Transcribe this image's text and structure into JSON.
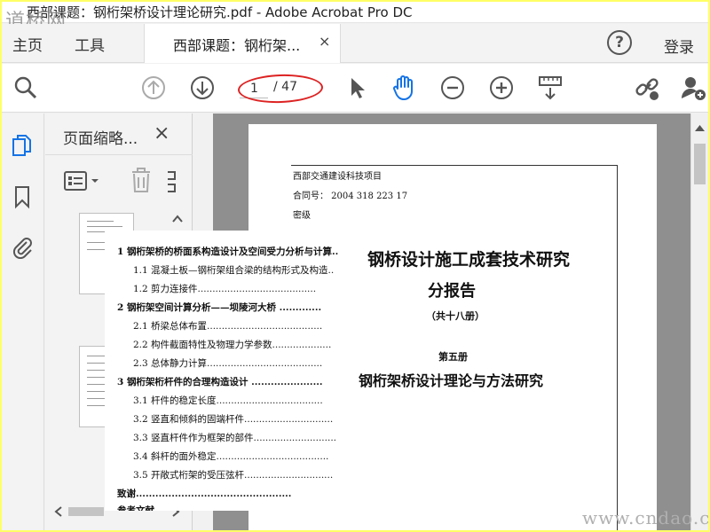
{
  "titlebar": {
    "title": "西部课题：钢桁架桥设计理论研究.pdf - Adobe Acrobat Pro DC",
    "logo_text": "道桥网"
  },
  "menubar": {
    "home_label": "主页",
    "tools_label": "工具",
    "tab_label": "西部课题：钢桁架...",
    "tab_close": "×",
    "help_symbol": "?",
    "login_label": "登录"
  },
  "toolbar": {
    "current_page": "1",
    "total_pages": "/ 47",
    "icons": [
      "search-icon",
      "page-up-icon",
      "page-down-icon",
      "select-arrow-icon",
      "hand-tool-icon",
      "zoom-out-icon",
      "zoom-in-icon",
      "fit-page-icon",
      "share-link-icon",
      "add-user-icon"
    ],
    "accent_color": "#1473e6",
    "annotation_color": "#dd2222"
  },
  "left_rail": {
    "icons": [
      "page-thumbnails-icon",
      "bookmark-icon",
      "attachment-icon"
    ]
  },
  "thumbnail_panel": {
    "title": "页面缩略...",
    "close": "×"
  },
  "document": {
    "header_lines": [
      "西部交通建设科技项目",
      "合同号：  2004 318 223 17",
      "密级"
    ],
    "main_title": "钢桥设计施工成套技术研究",
    "sub_title": "分报告",
    "volume_count": "（共十八册）",
    "volume_number": "第五册",
    "volume_title": "钢桁架桥设计理论与方法研究"
  },
  "toc": {
    "lines": [
      "1  钢桁架桥的桥面系构造设计及空间受力分析与计算..",
      "1.1 混凝土板—钢桁架组合梁的结构形式及构造..",
      "1.2  剪力连接件........................................",
      "2  钢桁架空间计算分析——坝陵河大桥 .............",
      "2.1 桥梁总体布置.......................................",
      "2.2  构件截面特性及物理力学参数....................",
      "2.3 总体静力计算.......................................",
      "3  钢桁架桁杆件的合理构造设计 ......................",
      "3.1  杆件的稳定长度....................................",
      "3.2  竖直和倾斜的固端杆件..............................",
      "3.3  竖直杆件作为框架的部件............................",
      "3.4  斜杆的面外稳定......................................",
      "3.5 开敞式桁架的受压弦杆..............................",
      "致谢................................................",
      "参考文献"
    ]
  },
  "watermark": "www.cndao.com"
}
